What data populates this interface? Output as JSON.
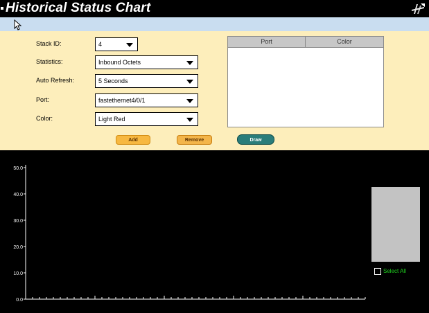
{
  "window": {
    "title": "Historical Status Chart"
  },
  "form": {
    "rows": [
      {
        "label": "Stack ID:",
        "value": "4"
      },
      {
        "label": "Statistics:",
        "value": "Inbound Octets"
      },
      {
        "label": "Auto Refresh:",
        "value": "5 Seconds"
      },
      {
        "label": "Port:",
        "value": "fastethernet4/0/1"
      },
      {
        "label": "Color:",
        "value": "Light Red"
      }
    ]
  },
  "port_table": {
    "columns": [
      "Port",
      "Color"
    ]
  },
  "buttons": {
    "add": "Add",
    "remove": "Remove",
    "draw": "Draw"
  },
  "select_all": {
    "label": "Select All",
    "checked": false
  },
  "colors": {
    "title_bar": "#000000",
    "form_bg": "#fdeebb",
    "chart_bg": "#000000",
    "axis": "#ffffff",
    "select_all_text": "#1fd11f",
    "draw_button": "#2a7d7a",
    "add_button": "#f7b840"
  },
  "chart_data": {
    "type": "line",
    "title": "",
    "xlabel": "",
    "ylabel": "",
    "y_ticks": [
      "0.0",
      "10.0",
      "20.0",
      "30.0",
      "40.0",
      "50.0"
    ],
    "ylim": [
      0,
      50
    ],
    "series": [],
    "grid": false,
    "legend": "none"
  }
}
